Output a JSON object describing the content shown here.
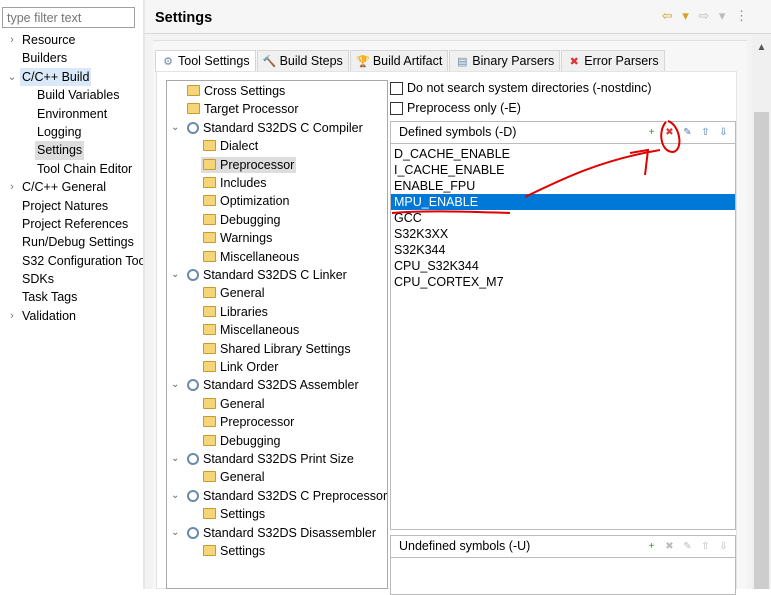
{
  "filter": {
    "placeholder": "type filter text"
  },
  "nav": [
    {
      "label": "Resource",
      "twisty": "›",
      "indent": 0
    },
    {
      "label": "Builders",
      "twisty": "",
      "indent": 0
    },
    {
      "label": "C/C++ Build",
      "twisty": "⌄",
      "indent": 0,
      "state": "expanded"
    },
    {
      "label": "Build Variables",
      "twisty": "",
      "indent": 1
    },
    {
      "label": "Environment",
      "twisty": "",
      "indent": 1
    },
    {
      "label": "Logging",
      "twisty": "",
      "indent": 1
    },
    {
      "label": "Settings",
      "twisty": "",
      "indent": 1,
      "state": "selected"
    },
    {
      "label": "Tool Chain Editor",
      "twisty": "",
      "indent": 1
    },
    {
      "label": "C/C++ General",
      "twisty": "›",
      "indent": 0
    },
    {
      "label": "Project Natures",
      "twisty": "",
      "indent": 0
    },
    {
      "label": "Project References",
      "twisty": "",
      "indent": 0
    },
    {
      "label": "Run/Debug Settings",
      "twisty": "",
      "indent": 0
    },
    {
      "label": "S32 Configuration Too",
      "twisty": "",
      "indent": 0
    },
    {
      "label": "SDKs",
      "twisty": "",
      "indent": 0
    },
    {
      "label": "Task Tags",
      "twisty": "",
      "indent": 0
    },
    {
      "label": "Validation",
      "twisty": "›",
      "indent": 0
    }
  ],
  "header": {
    "title": "Settings",
    "back": "⇦ ▾",
    "forward": "⇨ ▾",
    "menu": "⋮"
  },
  "tabs": [
    {
      "label": "Tool Settings",
      "icon": "gear-icon",
      "glyph": "⚙",
      "active": true
    },
    {
      "label": "Build Steps",
      "icon": "hammer-icon",
      "glyph": "🔨"
    },
    {
      "label": "Build Artifact",
      "icon": "trophy-icon",
      "glyph": "🏆"
    },
    {
      "label": "Binary Parsers",
      "icon": "binary-file-icon",
      "glyph": "▤"
    },
    {
      "label": "Error Parsers",
      "icon": "error-icon",
      "glyph": "✖"
    }
  ],
  "tree": [
    {
      "label": "Cross Settings",
      "level": 1,
      "type": "folder"
    },
    {
      "label": "Target Processor",
      "level": 1,
      "type": "folder"
    },
    {
      "label": "Standard S32DS C Compiler",
      "level": 0,
      "type": "tool"
    },
    {
      "label": "Dialect",
      "level": 2,
      "type": "folder"
    },
    {
      "label": "Preprocessor",
      "level": 2,
      "type": "folder",
      "selected": true
    },
    {
      "label": "Includes",
      "level": 2,
      "type": "folder"
    },
    {
      "label": "Optimization",
      "level": 2,
      "type": "folder"
    },
    {
      "label": "Debugging",
      "level": 2,
      "type": "folder"
    },
    {
      "label": "Warnings",
      "level": 2,
      "type": "folder"
    },
    {
      "label": "Miscellaneous",
      "level": 2,
      "type": "folder"
    },
    {
      "label": "Standard S32DS C Linker",
      "level": 0,
      "type": "tool"
    },
    {
      "label": "General",
      "level": 2,
      "type": "folder"
    },
    {
      "label": "Libraries",
      "level": 2,
      "type": "folder"
    },
    {
      "label": "Miscellaneous",
      "level": 2,
      "type": "folder"
    },
    {
      "label": "Shared Library Settings",
      "level": 2,
      "type": "folder"
    },
    {
      "label": "Link Order",
      "level": 2,
      "type": "folder"
    },
    {
      "label": "Standard S32DS Assembler",
      "level": 0,
      "type": "tool"
    },
    {
      "label": "General",
      "level": 2,
      "type": "folder"
    },
    {
      "label": "Preprocessor",
      "level": 2,
      "type": "folder"
    },
    {
      "label": "Debugging",
      "level": 2,
      "type": "folder"
    },
    {
      "label": "Standard S32DS Print Size",
      "level": 0,
      "type": "tool"
    },
    {
      "label": "General",
      "level": 2,
      "type": "folder"
    },
    {
      "label": "Standard S32DS C Preprocessor",
      "level": 0,
      "type": "tool"
    },
    {
      "label": "Settings",
      "level": 2,
      "type": "folder"
    },
    {
      "label": "Standard S32DS Disassembler",
      "level": 0,
      "type": "tool"
    },
    {
      "label": "Settings",
      "level": 2,
      "type": "folder"
    }
  ],
  "options": {
    "nostdinc": {
      "label": "Do not search system directories (-nostdinc)",
      "checked": false
    },
    "preprocess_only": {
      "label": "Preprocess only (-E)",
      "checked": false
    }
  },
  "defined": {
    "title": "Defined symbols (-D)",
    "symbols": [
      "D_CACHE_ENABLE",
      "I_CACHE_ENABLE",
      "ENABLE_FPU",
      "MPU_ENABLE",
      "GCC",
      "S32K3XX",
      "S32K344",
      "CPU_S32K344",
      "CPU_CORTEX_M7"
    ],
    "selected": "MPU_ENABLE"
  },
  "undefined": {
    "title": "Undefined symbols (-U)",
    "symbols": []
  },
  "toolbar": [
    {
      "name": "add",
      "glyph": "+"
    },
    {
      "name": "delete",
      "glyph": "✖"
    },
    {
      "name": "edit",
      "glyph": "✎"
    },
    {
      "name": "move-up",
      "glyph": "⇧"
    },
    {
      "name": "move-down",
      "glyph": "⇩"
    }
  ],
  "colors": {
    "selection": "#0078d7",
    "annotation": "#e00000"
  }
}
